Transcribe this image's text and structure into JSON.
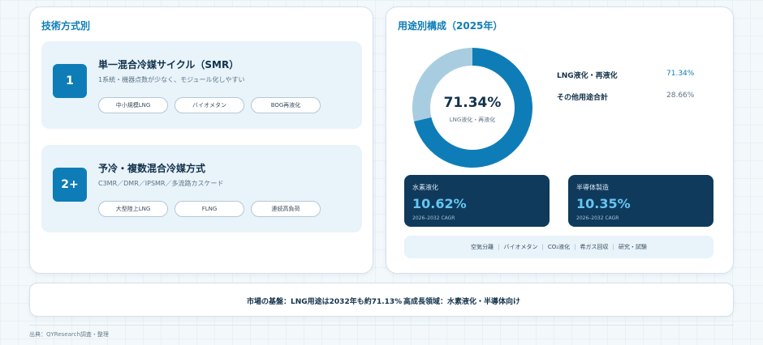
{
  "tech": {
    "title": "技術方式別",
    "items": [
      {
        "num": "1",
        "title": "単一混合冷媒サイクル（SMR）",
        "desc": "1系統・機器点数が少なく、モジュール化しやすい",
        "tags": [
          "中小規模LNG",
          "バイオメタン",
          "BOG再液化"
        ]
      },
      {
        "num": "2+",
        "title": "予冷・複数混合冷媒方式",
        "desc": "C3MR／DMR／IPSMR／多流路カスケード",
        "tags": [
          "大型陸上LNG",
          "FLNG",
          "連続高負荷"
        ]
      }
    ]
  },
  "usage": {
    "title": "用途別構成（2025年）",
    "center_value": "71.34%",
    "center_label": "LNG液化・再液化",
    "legend": [
      {
        "label": "LNG液化・再液化",
        "value": "71.34%"
      },
      {
        "label": "その他用途合計",
        "value": "28.66%"
      }
    ],
    "kpis": [
      {
        "label": "水素液化",
        "value": "10.62%",
        "note": "2026–2032 CAGR"
      },
      {
        "label": "半導体製造",
        "value": "10.35%",
        "note": "2026–2032 CAGR"
      }
    ],
    "apps": [
      "空気分離",
      "バイオメタン",
      "CO₂液化",
      "希ガス回収",
      "研究・試験"
    ]
  },
  "chart_data": {
    "type": "pie",
    "title": "用途別構成（2025年）",
    "labels": [
      "LNG液化・再液化",
      "その他用途合計"
    ],
    "values": [
      71.34,
      28.66
    ],
    "colors": [
      "#0e7db7",
      "#a9cde0"
    ]
  },
  "footer": {
    "basis": "市場の基盤：LNG用途は2032年も約71.13%",
    "growth": "高成長領域：水素液化・半導体向け"
  },
  "source": "出典：QYResearch調査・整理"
}
